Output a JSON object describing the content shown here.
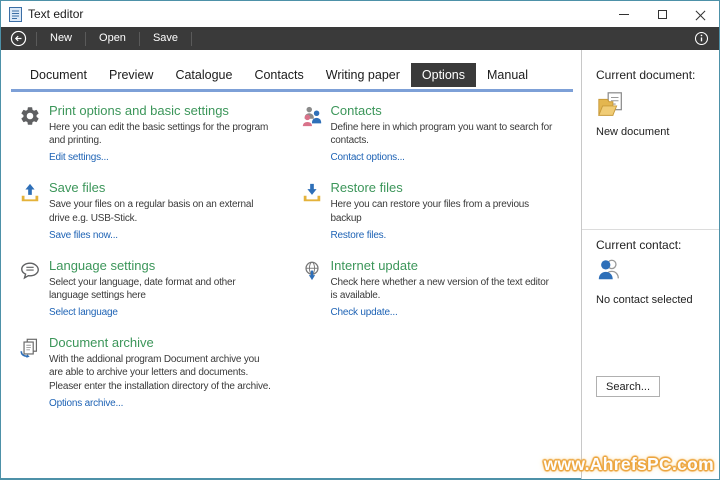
{
  "window": {
    "title": "Text editor",
    "controls": [
      "minimize",
      "maximize",
      "close"
    ]
  },
  "toolbar": {
    "back_icon": "back-circle-arrow",
    "buttons": [
      "New",
      "Open",
      "Save"
    ],
    "info_icon": "info-circle"
  },
  "tabs": [
    {
      "label": "Document",
      "active": false
    },
    {
      "label": "Preview",
      "active": false
    },
    {
      "label": "Catalogue",
      "active": false
    },
    {
      "label": "Contacts",
      "active": false
    },
    {
      "label": "Writing paper",
      "active": false
    },
    {
      "label": "Options",
      "active": true
    },
    {
      "label": "Manual",
      "active": false
    }
  ],
  "sections": {
    "left": [
      {
        "icon": "gear-icon",
        "title": "Print options and basic settings",
        "description": "Here you can edit the basic settings for the program and printing.",
        "link": "Edit settings..."
      },
      {
        "icon": "save-upload-icon",
        "title": "Save files",
        "description": "Save your files on a regular basis on an external drive e.g. USB-Stick.",
        "link": "Save files now..."
      },
      {
        "icon": "language-bubble-icon",
        "title": "Language settings",
        "description": "Select your language, date format and other language settings here",
        "link": "Select language"
      },
      {
        "icon": "document-archive-icon",
        "title": "Document archive",
        "description": "With the addional program Document archive you are able to archive your letters and documents. Pleaser enter the installation directory of the archive.",
        "link": "Options archive..."
      }
    ],
    "right": [
      {
        "icon": "contacts-icon",
        "title": "Contacts",
        "description": "Define here in which program you want to search for contacts.",
        "link": "Contact options..."
      },
      {
        "icon": "restore-download-icon",
        "title": "Restore files",
        "description": "Here you can restore your files from a previous backup",
        "link": "Restore files."
      },
      {
        "icon": "internet-update-icon",
        "title": "Internet update",
        "description": "Check here whether a new version of the text editor is available.",
        "link": "Check update..."
      }
    ]
  },
  "sidebar": {
    "current_document_label": "Current document:",
    "document_icon": "folder-document-icon",
    "document_name": "New document",
    "current_contact_label": "Current contact:",
    "contact_icon": "person-icon",
    "contact_status": "No contact selected",
    "search_button": "Search..."
  },
  "watermark": "www.AhrefsPC.com",
  "colors": {
    "accent_green": "#3c965a",
    "link_blue": "#1e63b5",
    "toolbar_dark": "#3a3a3a",
    "tab_underline": "#7da0d7",
    "window_border": "#4d91a8",
    "icon_blue": "#2e6fb8",
    "tray_yellow": "#e4b23a"
  }
}
